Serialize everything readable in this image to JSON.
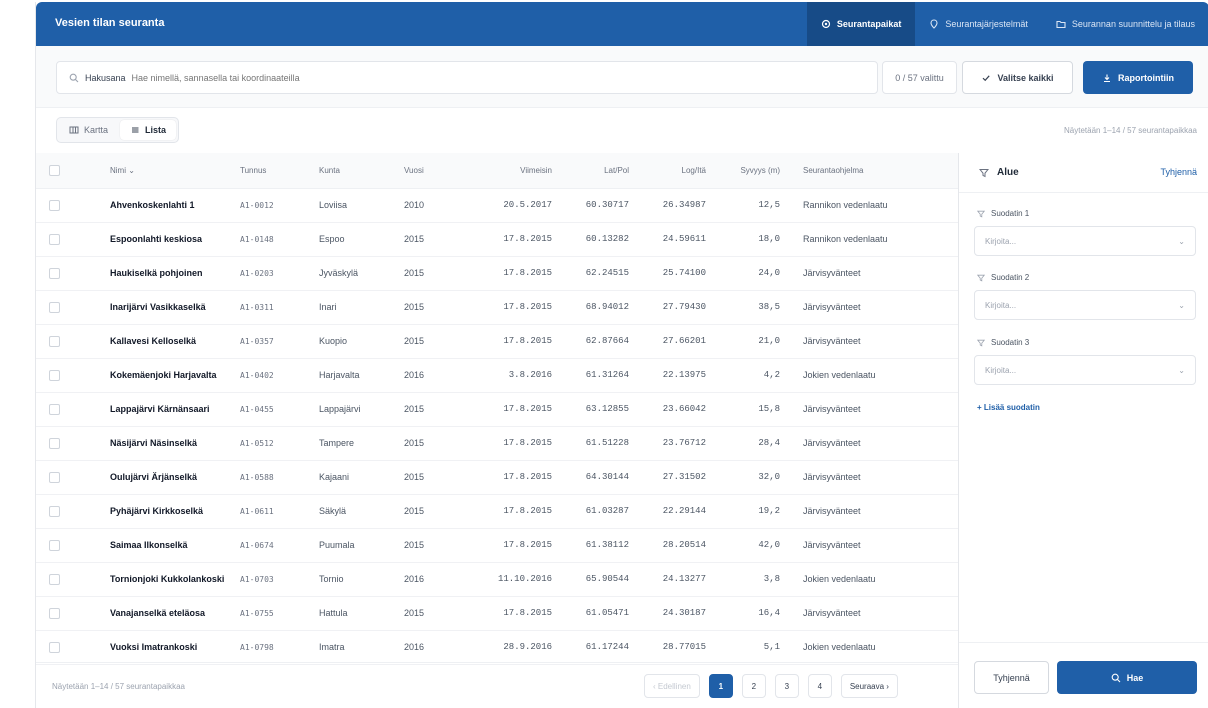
{
  "app": {
    "title": "Vesien tilan seuranta"
  },
  "nav": [
    {
      "label": "Seurantapaikat",
      "icon": "location-icon",
      "active": true
    },
    {
      "label": "Seurantajärjestelmät",
      "icon": "pin-icon",
      "active": false
    },
    {
      "label": "Seurannan suunnittelu ja tilaus",
      "icon": "folder-icon",
      "active": false
    }
  ],
  "search": {
    "label": "Hakusana",
    "placeholder": "Hae nimellä, sanna­sella tai koordinaateilla",
    "counter": "0 / 57 valittu"
  },
  "actions": {
    "select_all": "Valitse kaikki",
    "report": "Raportointiin"
  },
  "view": {
    "map": "Kartta",
    "list": "Lista",
    "showing_top": "Näytetään 1–14 / 57 seurantapaikkaa"
  },
  "table": {
    "headers": {
      "name": "Nimi",
      "id": "Tunnus",
      "kunta": "Kunta",
      "vuosi": "Vuosi",
      "last": "Viimeisin",
      "lat": "Lat/Pol",
      "lon": "Log/Itä",
      "depth": "Syvyys (m)",
      "prog": "Seurantaohjelma"
    },
    "rows": [
      {
        "name": "Ahvenkoskenlahti 1",
        "id": "A1-0012",
        "kunta": "Loviisa",
        "vuosi": "2010",
        "last": "20.5.2017",
        "lat": "60.30717",
        "lon": "26.34987",
        "depth": "12,5",
        "prog": "Rannikon vedenlaatu"
      },
      {
        "name": "Espoonlahti keskiosa",
        "id": "A1-0148",
        "kunta": "Espoo",
        "vuosi": "2015",
        "last": "17.8.2015",
        "lat": "60.13282",
        "lon": "24.59611",
        "depth": "18,0",
        "prog": "Rannikon vedenlaatu"
      },
      {
        "name": "Haukiselkä pohjoinen",
        "id": "A1-0203",
        "kunta": "Jyväskylä",
        "vuosi": "2015",
        "last": "17.8.2015",
        "lat": "62.24515",
        "lon": "25.74100",
        "depth": "24,0",
        "prog": "Järvisyvänteet"
      },
      {
        "name": "Inarijärvi Vasikkaselkä",
        "id": "A1-0311",
        "kunta": "Inari",
        "vuosi": "2015",
        "last": "17.8.2015",
        "lat": "68.94012",
        "lon": "27.79430",
        "depth": "38,5",
        "prog": "Järvisyvänteet"
      },
      {
        "name": "Kallavesi Kelloselkä",
        "id": "A1-0357",
        "kunta": "Kuopio",
        "vuosi": "2015",
        "last": "17.8.2015",
        "lat": "62.87664",
        "lon": "27.66201",
        "depth": "21,0",
        "prog": "Järvisyvänteet"
      },
      {
        "name": "Kokemäenjoki Harjavalta",
        "id": "A1-0402",
        "kunta": "Harjavalta",
        "vuosi": "2016",
        "last": "3.8.2016",
        "lat": "61.31264",
        "lon": "22.13975",
        "depth": "4,2",
        "prog": "Jokien vedenlaatu"
      },
      {
        "name": "Lappajärvi Kärnänsaari",
        "id": "A1-0455",
        "kunta": "Lappajärvi",
        "vuosi": "2015",
        "last": "17.8.2015",
        "lat": "63.12855",
        "lon": "23.66042",
        "depth": "15,8",
        "prog": "Järvisyvänteet"
      },
      {
        "name": "Näsijärvi Näsinselkä",
        "id": "A1-0512",
        "kunta": "Tampere",
        "vuosi": "2015",
        "last": "17.8.2015",
        "lat": "61.51228",
        "lon": "23.76712",
        "depth": "28,4",
        "prog": "Järvisyvänteet"
      },
      {
        "name": "Oulujärvi Ärjänselkä",
        "id": "A1-0588",
        "kunta": "Kajaani",
        "vuosi": "2015",
        "last": "17.8.2015",
        "lat": "64.30144",
        "lon": "27.31502",
        "depth": "32,0",
        "prog": "Järvisyvänteet"
      },
      {
        "name": "Pyhäjärvi Kirkkoselkä",
        "id": "A1-0611",
        "kunta": "Säkylä",
        "vuosi": "2015",
        "last": "17.8.2015",
        "lat": "61.03287",
        "lon": "22.29144",
        "depth": "19,2",
        "prog": "Järvisyvänteet"
      },
      {
        "name": "Saimaa Ilkonselkä",
        "id": "A1-0674",
        "kunta": "Puumala",
        "vuosi": "2015",
        "last": "17.8.2015",
        "lat": "61.38112",
        "lon": "28.20514",
        "depth": "42,0",
        "prog": "Järvisyvänteet"
      },
      {
        "name": "Tornionjoki Kukkolankoski",
        "id": "A1-0703",
        "kunta": "Tornio",
        "vuosi": "2016",
        "last": "11.10.2016",
        "lat": "65.90544",
        "lon": "24.13277",
        "depth": "3,8",
        "prog": "Jokien vedenlaatu"
      },
      {
        "name": "Vanajanselkä eteläosa",
        "id": "A1-0755",
        "kunta": "Hattula",
        "vuosi": "2015",
        "last": "17.8.2015",
        "lat": "61.05471",
        "lon": "24.30187",
        "depth": "16,4",
        "prog": "Järvisyvänteet"
      },
      {
        "name": "Vuoksi Imatrankoski",
        "id": "A1-0798",
        "kunta": "Imatra",
        "vuosi": "2016",
        "last": "28.9.2016",
        "lat": "61.17244",
        "lon": "28.77015",
        "depth": "5,1",
        "prog": "Jokien vedenlaatu"
      }
    ]
  },
  "footer": {
    "showing": "Näytetään 1–14 / 57 seurantapaikkaa",
    "prev": "Edellinen",
    "pages": [
      "1",
      "2",
      "3",
      "4"
    ],
    "current_page": "1",
    "next": "Seuraava"
  },
  "sidebar": {
    "title": "Alue",
    "clear": "Tyhjennä",
    "filters": [
      {
        "label": "Suodatin 1",
        "placeholder": "Kirjoita..."
      },
      {
        "label": "Suodatin 2",
        "placeholder": "Kirjoita..."
      },
      {
        "label": "Suodatin 3",
        "placeholder": "Kirjoita..."
      }
    ],
    "add_filter": "+ Lisää suodatin",
    "clear_button": "Tyhjennä",
    "search_button": "Hae"
  },
  "colors": {
    "primary": "#1f5fa8",
    "primary_dark": "#174b87"
  }
}
